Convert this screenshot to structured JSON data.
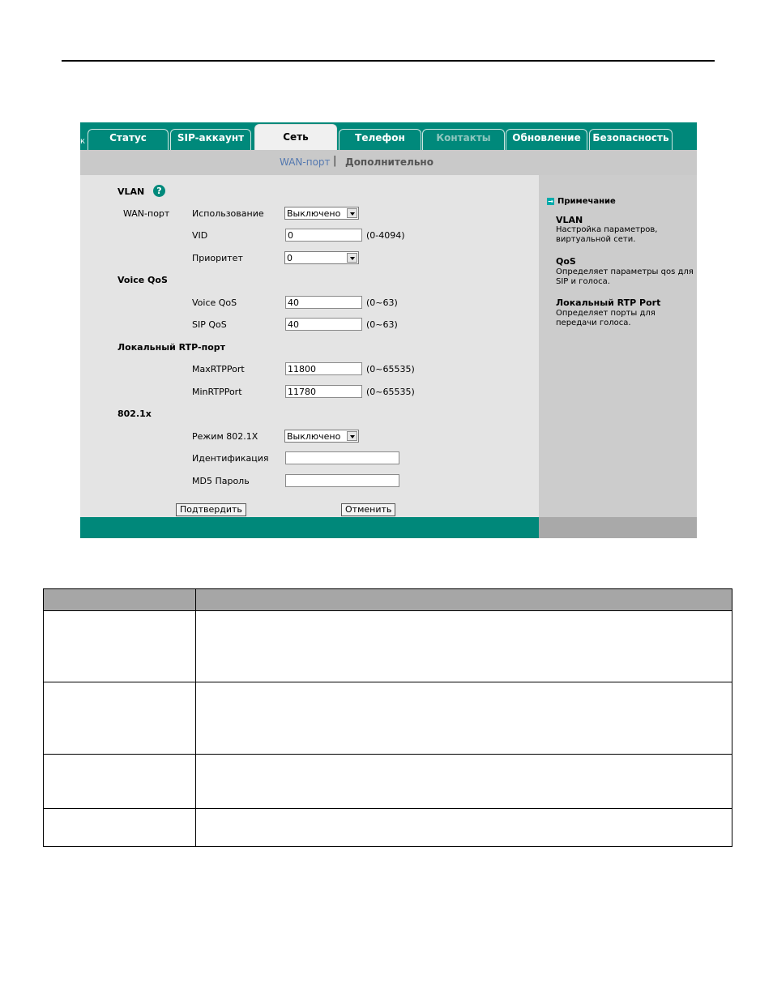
{
  "tabs": {
    "stub": "к",
    "status": "Статус",
    "sip": "SIP-аккаунт",
    "network": "Сеть",
    "phone": "Телефон",
    "contacts": "Контакты",
    "update": "Обновление",
    "security": "Безопасность"
  },
  "subnav": {
    "wan": "WAN-порт",
    "separator": "|",
    "advanced": "Дополнительно"
  },
  "vlan": {
    "title": "VLAN",
    "help": "?",
    "wan_label": "WAN-порт",
    "usage_label": "Использование",
    "usage_value": "Выключено",
    "vid_label": "VID",
    "vid_value": "0",
    "vid_range": "(0-4094)",
    "priority_label": "Приоритет",
    "priority_value": "0"
  },
  "qos": {
    "title": "Voice QoS",
    "voice_label": "Voice QoS",
    "voice_value": "40",
    "voice_range": "(0~63)",
    "sip_label": "SIP QoS",
    "sip_value": "40",
    "sip_range": "(0~63)"
  },
  "rtp": {
    "title": "Локальный RTP-порт",
    "max_label": "MaxRTPPort",
    "max_value": "11800",
    "max_range": "(0~65535)",
    "min_label": "MinRTPPort",
    "min_value": "11780",
    "min_range": "(0~65535)"
  },
  "dot1x": {
    "title": "802.1x",
    "mode_label": "Режим 802.1X",
    "mode_value": "Выключено",
    "id_label": "Идентификация",
    "id_value": "",
    "pwd_label": "MD5 Пароль",
    "pwd_value": ""
  },
  "buttons": {
    "confirm": "Подтвердить",
    "cancel": "Отменить"
  },
  "note": {
    "icon": "→",
    "header": "Примечание",
    "vlan_title": "VLAN",
    "vlan_desc": "Настройка параметров, виртуальной сети.",
    "qos_title": "QoS",
    "qos_desc": "Определяет параметры qos для SIP и голоса.",
    "rtp_title": "Локальный RTP Port",
    "rtp_desc": "Определяет порты для передачи голоса."
  },
  "colors": {
    "teal": "#00887a",
    "panel": "#e4e4e4",
    "side": "#cccccc",
    "table_header": "#a6a6a6"
  }
}
